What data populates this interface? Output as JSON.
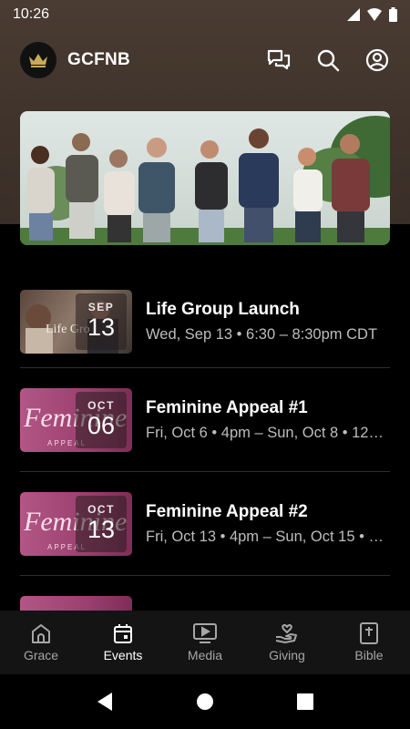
{
  "status_bar": {
    "time": "10:26"
  },
  "app_bar": {
    "title": "GCFNB"
  },
  "events": [
    {
      "month": "SEP",
      "day": "13",
      "title": "Life Group Launch",
      "subtitle": "Wed, Sep 13 • 6:30 – 8:30pm CDT",
      "thumb_text": "Life Gro"
    },
    {
      "month": "OCT",
      "day": "06",
      "title": "Feminine Appeal #1",
      "subtitle": "Fri, Oct 6 • 4pm – Sun, Oct 8 • 12…",
      "thumb_text": "Feminine",
      "thumb_sub": "APPEAL"
    },
    {
      "month": "OCT",
      "day": "13",
      "title": "Feminine Appeal #2",
      "subtitle": "Fri, Oct 13 • 4pm – Sun, Oct 15 • …",
      "thumb_text": "Feminine",
      "thumb_sub": "APPEAL"
    }
  ],
  "bottom_nav": [
    {
      "label": "Grace",
      "icon": "church-icon"
    },
    {
      "label": "Events",
      "icon": "calendar-icon",
      "active": true
    },
    {
      "label": "Media",
      "icon": "media-play-icon"
    },
    {
      "label": "Giving",
      "icon": "giving-hand-icon"
    },
    {
      "label": "Bible",
      "icon": "bible-icon"
    }
  ],
  "colors": {
    "header_bg": "#4a3c33",
    "nav_bg": "#141414",
    "feminine_thumb": "#9b3f6e"
  }
}
